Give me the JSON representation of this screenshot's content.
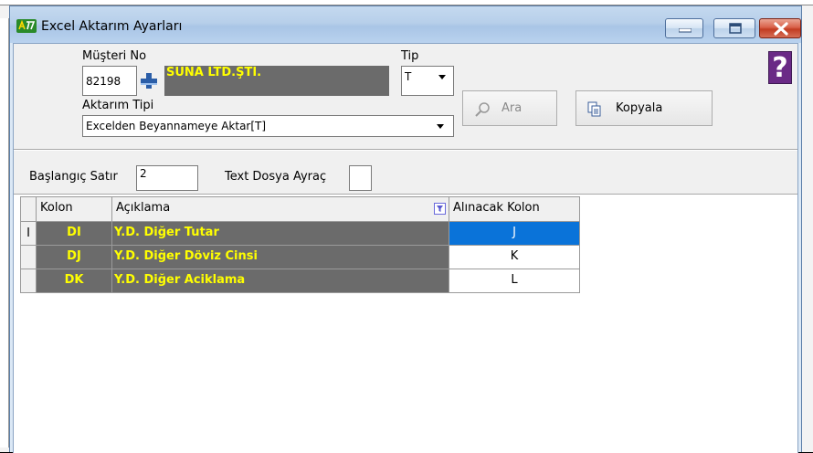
{
  "window": {
    "title": "Excel Aktarım Ayarları"
  },
  "form": {
    "customer_label": "Müşteri No",
    "customer_no": "82198",
    "company_name": "SUNA LTD.ŞTI.",
    "type_label": "Tip",
    "type_value": "T",
    "transfer_type_label": "Aktarım Tipi",
    "transfer_type_value": "Excelden Beyannameye Aktar[T]",
    "search_label": "Ara",
    "copy_label": "Kopyala",
    "start_row_label": "Başlangıç Satır",
    "start_row_value": "2",
    "text_separator_label": "Text Dosya Ayraç",
    "text_separator_value": ""
  },
  "grid": {
    "headers": [
      "Kolon",
      "Açıklama",
      "Alınacak Kolon"
    ],
    "rows": [
      {
        "kolon": "DI",
        "aciklama": "Y.D. Diğer Tutar",
        "alinacak": "J"
      },
      {
        "kolon": "DJ",
        "aciklama": "Y.D. Diğer Döviz Cinsi",
        "alinacak": "K"
      },
      {
        "kolon": "DK",
        "aciklama": "Y.D. Diğer Aciklama",
        "alinacak": "L"
      }
    ],
    "row_indicator": "I"
  },
  "colors": {
    "row_bg": "#6b6b6b",
    "row_text": "#ffff00",
    "selection": "#0a73d9"
  }
}
